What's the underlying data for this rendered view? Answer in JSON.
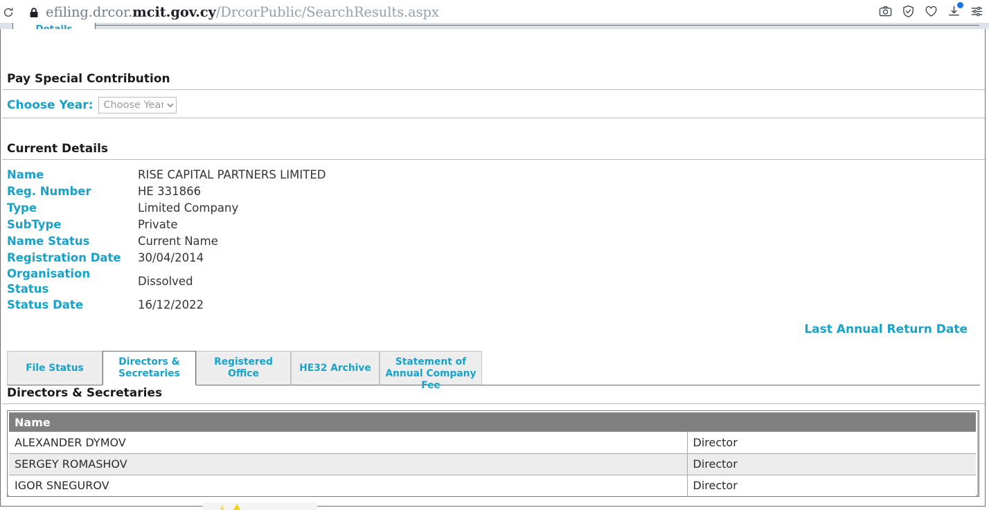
{
  "browser": {
    "url_scheme_host": "efiling.drcor.",
    "url_domain_strong": "mcit.gov.cy",
    "url_path": "/DrcorPublic/SearchResults.aspx",
    "url_full": "efiling.drcor.mcit.gov.cy/DrcorPublic/SearchResults.aspx",
    "icons": {
      "reload": "reload-icon",
      "lock": "lock-icon",
      "camera": "camera-icon",
      "shield": "shield-check-icon",
      "heart": "heart-icon",
      "download": "download-icon",
      "settings": "sliders-icon"
    }
  },
  "outer_tabs": [
    {
      "label": "Details",
      "active": true
    }
  ],
  "sections": {
    "pay_special_contribution": {
      "title": "Pay Special Contribution",
      "choose_year_label": "Choose Year:",
      "choose_year_value": "Choose Year:",
      "choose_year_options": [
        "Choose Year:"
      ]
    },
    "current_details": {
      "title": "Current Details",
      "rows": [
        {
          "key": "Name",
          "value": "RISE CAPITAL PARTNERS LIMITED"
        },
        {
          "key": "Reg. Number",
          "value": "HE 331866"
        },
        {
          "key": "Type",
          "value": "Limited Company"
        },
        {
          "key": "SubType",
          "value": "Private"
        },
        {
          "key": "Name Status",
          "value": "Current Name"
        },
        {
          "key": "Registration Date",
          "value": "30/04/2014"
        },
        {
          "key": "Organisation Status",
          "value": "Dissolved"
        },
        {
          "key": "Status Date",
          "value": "16/12/2022"
        }
      ],
      "last_annual_return_date_label": "Last Annual Return Date"
    }
  },
  "inner_tabs": [
    {
      "label": "File Status",
      "active": false
    },
    {
      "label": "Directors & Secretaries",
      "active": true
    },
    {
      "label": "Registered Office",
      "active": false
    },
    {
      "label": "HE32 Archive",
      "active": false
    },
    {
      "label": "Statement of Annual Company Fee",
      "active": false
    }
  ],
  "directors_panel": {
    "title": "Directors & Secretaries",
    "columns": [
      "Name",
      ""
    ],
    "rows": [
      [
        "ALEXANDER DYMOV",
        "Director"
      ],
      [
        "SERGEY ROMASHOV",
        "Director"
      ],
      [
        "IGOR SNEGUROV",
        "Director"
      ]
    ]
  },
  "colors": {
    "accent_cyan": "#17a2c9",
    "table_header_grey": "#808080",
    "alt_row_grey": "#ececec",
    "chrome_band": "#dbe2ea",
    "download_badge": "#1a73e8",
    "warning_yellow": "#f2d01e"
  }
}
